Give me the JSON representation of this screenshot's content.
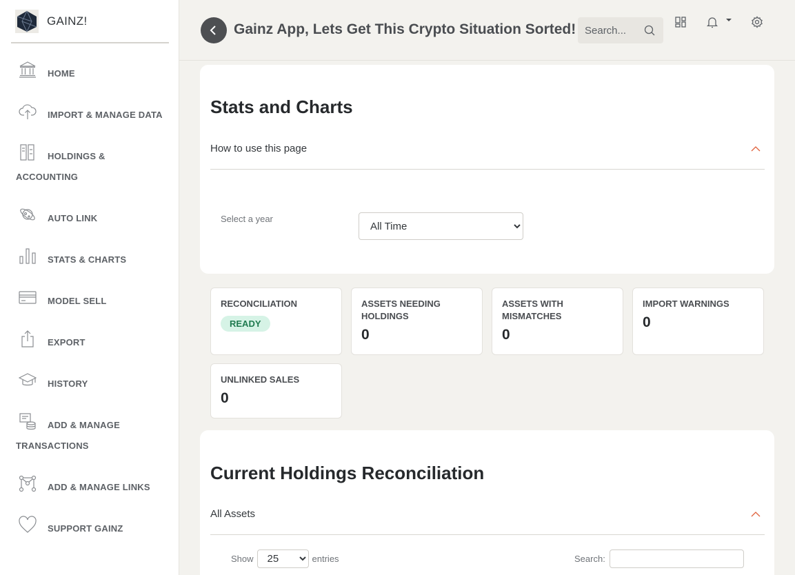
{
  "brand": {
    "name": "GAINZ!"
  },
  "sidebar": {
    "items": [
      {
        "label": "HOME",
        "icon": "bank-icon"
      },
      {
        "label": "IMPORT & MANAGE DATA",
        "icon": "cloud-upload-icon"
      },
      {
        "label": "HOLDINGS &",
        "label2": "ACCOUNTING",
        "icon": "ledger-icon"
      },
      {
        "label": "AUTO LINK",
        "icon": "planet-icon"
      },
      {
        "label": "STATS & CHARTS",
        "icon": "bar-chart-icon"
      },
      {
        "label": "MODEL SELL",
        "icon": "card-icon"
      },
      {
        "label": "EXPORT",
        "icon": "share-icon"
      },
      {
        "label": "HISTORY",
        "icon": "mortarboard-icon"
      },
      {
        "label": "ADD & MANAGE",
        "label2": "TRANSACTIONS",
        "icon": "coins-icon"
      },
      {
        "label": "ADD & MANAGE LINKS",
        "icon": "network-icon"
      },
      {
        "label": "SUPPORT GAINZ",
        "icon": "heart-icon"
      }
    ]
  },
  "header": {
    "title": "Gainz App, Lets Get This Crypto Situation Sorted!",
    "search_placeholder": "Search..."
  },
  "stats_card": {
    "title": "Stats and Charts",
    "accordion_label": "How to use this page",
    "year_label": "Select a year",
    "year_selected": "All Time"
  },
  "stats": {
    "reconciliation": {
      "title": "RECONCILIATION",
      "badge": "READY"
    },
    "assets_needing_holdings": {
      "title": "ASSETS NEEDING HOLDINGS",
      "value": "0"
    },
    "assets_with_mismatches": {
      "title": "ASSETS WITH MISMATCHES",
      "value": "0"
    },
    "import_warnings": {
      "title": "IMPORT WARNINGS",
      "value": "0"
    },
    "unlinked_sales": {
      "title": "UNLINKED SALES",
      "value": "0"
    }
  },
  "reconciliation_card": {
    "title": "Current Holdings Reconciliation",
    "accordion_label": "All Assets",
    "show_label": "Show",
    "entries_value": "25",
    "entries_label": "entries",
    "search_label": "Search:"
  },
  "colors": {
    "accent": "#e0603a",
    "badge_bg": "#d6f3e6",
    "badge_text": "#1f7a4f",
    "background": "#f3f2ee"
  }
}
